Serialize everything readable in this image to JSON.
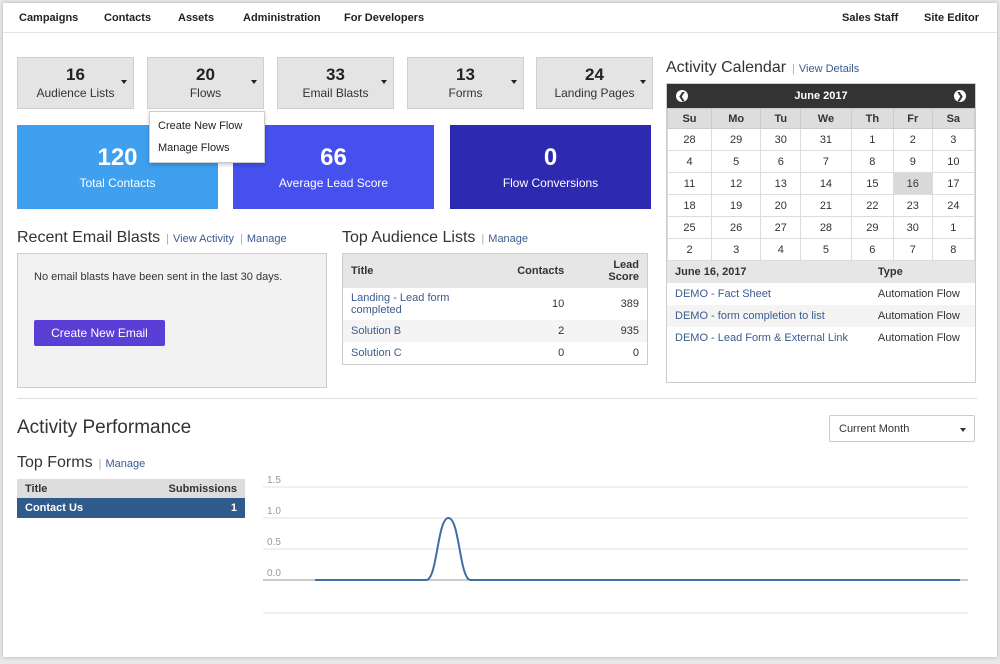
{
  "nav": {
    "left": [
      "Campaigns",
      "Contacts",
      "Assets",
      "Administration",
      "For Developers"
    ],
    "right": [
      "Sales Staff",
      "Site Editor"
    ]
  },
  "stats": [
    {
      "value": "16",
      "label": "Audience Lists"
    },
    {
      "value": "20",
      "label": "Flows"
    },
    {
      "value": "33",
      "label": "Email Blasts"
    },
    {
      "value": "13",
      "label": "Forms"
    },
    {
      "value": "24",
      "label": "Landing Pages"
    }
  ],
  "flows_dropdown": [
    "Create New Flow",
    "Manage Flows"
  ],
  "kpis": [
    {
      "value": "120",
      "label": "Total Contacts",
      "color": "#3fa0ef"
    },
    {
      "value": "66",
      "label": "Average Lead Score",
      "color": "#4550ee"
    },
    {
      "value": "0",
      "label": "Flow Conversions",
      "color": "#2d29b0"
    }
  ],
  "recent_email": {
    "title": "Recent Email Blasts",
    "links": [
      "View Activity",
      "Manage"
    ],
    "message": "No email blasts have been sent in the last 30 days.",
    "button": "Create New Email"
  },
  "audience": {
    "title": "Top Audience Lists",
    "link": "Manage",
    "columns": [
      "Title",
      "Contacts",
      "Lead Score"
    ],
    "rows": [
      [
        "Landing - Lead form completed",
        "10",
        "389"
      ],
      [
        "Solution B",
        "2",
        "935"
      ],
      [
        "Solution C",
        "0",
        "0"
      ]
    ]
  },
  "calendar": {
    "title": "Activity Calendar",
    "link": "View Details",
    "month": "June 2017",
    "days": [
      "Su",
      "Mo",
      "Tu",
      "We",
      "Th",
      "Fr",
      "Sa"
    ],
    "weeks": [
      [
        "28",
        "29",
        "30",
        "31",
        "1",
        "2",
        "3"
      ],
      [
        "4",
        "5",
        "6",
        "7",
        "8",
        "9",
        "10"
      ],
      [
        "11",
        "12",
        "13",
        "14",
        "15",
        "16",
        "17"
      ],
      [
        "18",
        "19",
        "20",
        "21",
        "22",
        "23",
        "24"
      ],
      [
        "25",
        "26",
        "27",
        "28",
        "29",
        "30",
        "1"
      ],
      [
        "2",
        "3",
        "4",
        "5",
        "6",
        "7",
        "8"
      ]
    ],
    "selected": "16",
    "events_header": [
      "June 16, 2017",
      "Type"
    ],
    "events": [
      [
        "DEMO - Fact Sheet",
        "Automation Flow"
      ],
      [
        "DEMO - form completion to list",
        "Automation Flow"
      ],
      [
        "DEMO - Lead Form & External Link",
        "Automation Flow"
      ]
    ]
  },
  "performance": {
    "title": "Activity Performance",
    "period": "Current Month"
  },
  "top_forms": {
    "title": "Top Forms",
    "link": "Manage",
    "columns": [
      "Title",
      "Submissions"
    ],
    "rows": [
      [
        "Contact Us",
        "1"
      ]
    ]
  },
  "chart_data": {
    "type": "line",
    "title": "",
    "xlabel": "",
    "ylabel": "",
    "yticks": [
      "1.5",
      "1.0",
      "0.5",
      "0.0"
    ],
    "ylim": [
      0,
      1.5
    ],
    "x": [
      1,
      2,
      3,
      4,
      5,
      6,
      7,
      8,
      9,
      10,
      11,
      12,
      13,
      14,
      15,
      16,
      17,
      18,
      19,
      20,
      21,
      22,
      23,
      24,
      25,
      26,
      27,
      28,
      29,
      30
    ],
    "values": [
      0,
      0,
      0,
      0,
      0,
      0,
      1,
      0,
      0,
      0,
      0,
      0,
      0,
      0,
      0,
      0,
      0,
      0,
      0,
      0,
      0,
      0,
      0,
      0,
      0,
      0,
      0,
      0,
      0,
      0
    ],
    "color": "#3d6ea6",
    "grid": true
  }
}
